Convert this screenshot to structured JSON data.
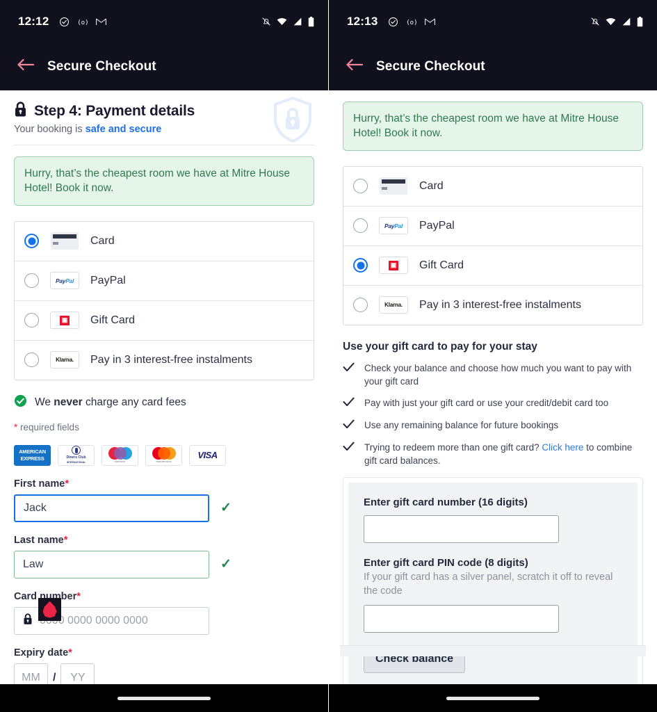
{
  "left": {
    "status": {
      "time": "12:12",
      "icons_left": [
        "check-circle-icon",
        "cast-icon",
        "gmail-icon"
      ],
      "icons_right": [
        "notifications-off-icon",
        "wifi-icon",
        "signal-icon",
        "battery-icon"
      ]
    },
    "appbar": {
      "title": "Secure Checkout",
      "back_icon": "back-arrow-icon"
    },
    "step": {
      "title": "Step 4: Payment details",
      "subtitle_prefix": "Your booking is ",
      "subtitle_link": "safe and secure",
      "lock_icon": "lock-icon",
      "shield_icon": "shield-lock-icon"
    },
    "banner": {
      "text": "Hurry, that’s the cheapest room we have at Mitre House Hotel! Book it now."
    },
    "payment_methods": [
      {
        "label": "Card",
        "logo": "generic-card-icon",
        "selected": true
      },
      {
        "label": "PayPal",
        "logo": "paypal-logo",
        "selected": false
      },
      {
        "label": "Gift Card",
        "logo": "gift-card-logo",
        "selected": false
      },
      {
        "label": "Pay in 3 interest-free instalments",
        "logo": "klarna-logo",
        "selected": false
      }
    ],
    "fees": {
      "prefix": "We ",
      "bold": "never",
      "suffix": " charge any card fees",
      "icon": "check-circle-filled-icon"
    },
    "required_note": {
      "star": "*",
      "text": " required fields"
    },
    "brands": [
      {
        "name": "american-express-logo",
        "line1": "AMERICAN",
        "line2": "EXPRESS"
      },
      {
        "name": "diners-club-logo",
        "line1": "Diners Club",
        "line2": "INTERNATIONAL"
      },
      {
        "name": "maestro-logo",
        "line1": "maestro"
      },
      {
        "name": "mastercard-logo",
        "line1": "mastercard"
      },
      {
        "name": "visa-logo",
        "line1": "VISA"
      }
    ],
    "form": {
      "first_name": {
        "label": "First name",
        "star": "*",
        "value": "Jack",
        "state": "focused",
        "valid_icon": "✓"
      },
      "last_name": {
        "label": "Last name",
        "star": "*",
        "value": "Law",
        "state": "valid",
        "valid_icon": "✓"
      },
      "card_number": {
        "label": "Card number",
        "star": "*",
        "placeholder": "0000 0000 0000 0000",
        "lock_icon": "lock-icon"
      },
      "expiry": {
        "label": "Expiry date",
        "star": "*",
        "month_placeholder": "MM",
        "separator": "/",
        "year_placeholder": "YY"
      }
    },
    "cursor_marker": {
      "icon": "red-drop-cursor"
    }
  },
  "right": {
    "status": {
      "time": "12:13"
    },
    "appbar": {
      "title": "Secure Checkout",
      "back_icon": "back-arrow-icon"
    },
    "banner": {
      "text": "Hurry, that’s the cheapest room we have at Mitre House Hotel! Book it now."
    },
    "payment_methods": [
      {
        "label": "Card",
        "logo": "generic-card-icon",
        "selected": false
      },
      {
        "label": "PayPal",
        "logo": "paypal-logo",
        "selected": false
      },
      {
        "label": "Gift Card",
        "logo": "gift-card-logo",
        "selected": true
      },
      {
        "label": "Pay in 3 interest-free instalments",
        "logo": "klarna-logo",
        "selected": false
      }
    ],
    "gift": {
      "heading": "Use your gift card to pay for your stay",
      "bullets": [
        {
          "text": "Check your balance and choose how much you want to pay with your gift card"
        },
        {
          "text": "Pay with just your gift card or use your credit/debit card too"
        },
        {
          "text": "Use any remaining balance for future bookings"
        },
        {
          "prefix": "Trying to redeem more than one gift card? ",
          "link": "Click here",
          "suffix": " to combine gift card balances."
        }
      ],
      "number_label": "Enter gift card number (16 digits)",
      "number_value": "",
      "pin_label": "Enter gift card PIN code (8 digits)",
      "pin_hint": "If your gift card has a silver panel, scratch it off to reveal the code",
      "pin_value": "",
      "check_button": "Check balance"
    }
  },
  "colors": {
    "appbar_bg": "#10111c",
    "accent_blue": "#1473e6",
    "link_blue": "#2f7ce0",
    "banner_bg": "#e6f5ea",
    "banner_border": "#9dcfae",
    "banner_text": "#2f7a4d",
    "required_star": "#e8233f",
    "success_green": "#1e8449",
    "back_arrow": "#f2879b"
  }
}
